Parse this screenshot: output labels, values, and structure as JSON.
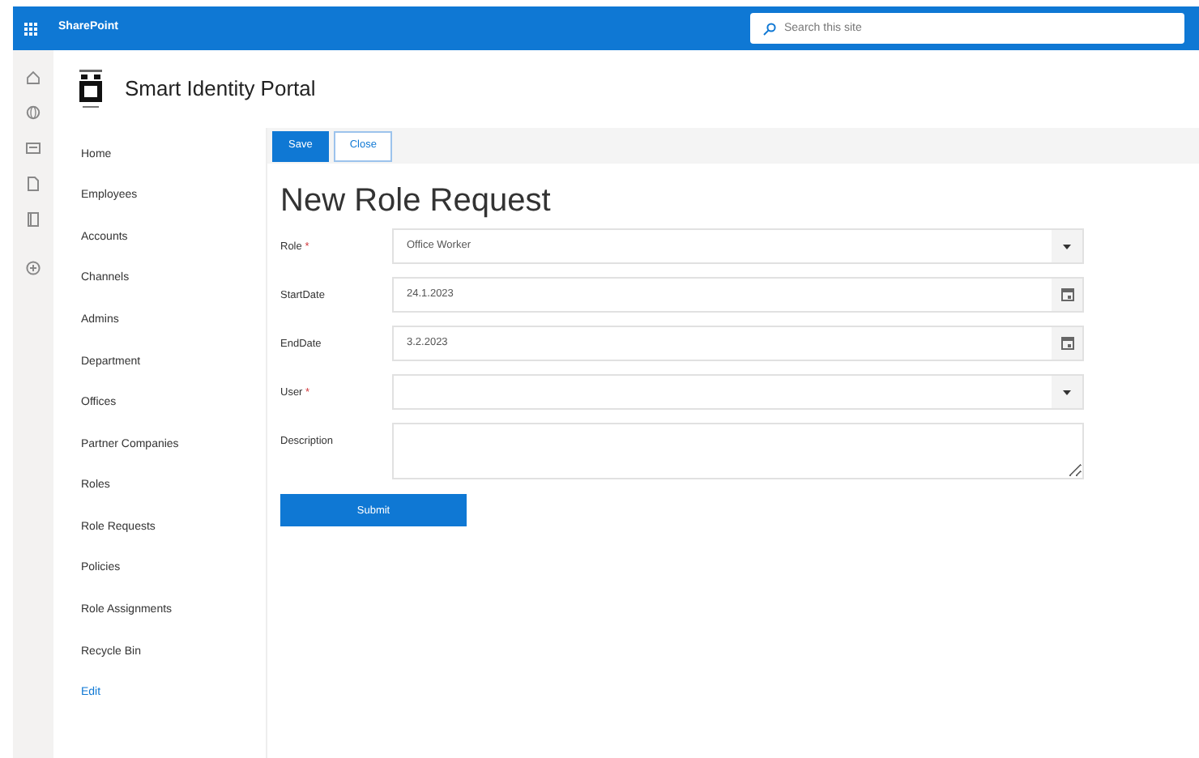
{
  "top_bar": {
    "app_name": "SharePoint",
    "search": {
      "placeholder": "Search this site"
    }
  },
  "site": {
    "title": "Smart Identity Portal"
  },
  "nav": {
    "items": [
      {
        "label": "Home",
        "kind": "link"
      },
      {
        "label": "Employees",
        "kind": "link"
      },
      {
        "label": "Accounts",
        "kind": "link"
      },
      {
        "label": "Channels",
        "kind": "link"
      },
      {
        "label": "Admins",
        "kind": "link"
      },
      {
        "label": "Department",
        "kind": "link"
      },
      {
        "label": "Offices",
        "kind": "link"
      },
      {
        "label": "Partner Companies",
        "kind": "link"
      },
      {
        "label": "Roles",
        "kind": "link"
      },
      {
        "label": "Role Requests",
        "kind": "link"
      },
      {
        "label": "Policies",
        "kind": "link"
      },
      {
        "label": "Role Assignments",
        "kind": "link"
      },
      {
        "label": "Recycle Bin",
        "kind": "link"
      },
      {
        "label": "Edit",
        "kind": "action"
      }
    ]
  },
  "toolbar": {
    "buttons": [
      {
        "label": "Save",
        "kind": "primary"
      },
      {
        "label": "Close",
        "kind": "secondary"
      }
    ]
  },
  "form": {
    "title": "New Role Request",
    "fields": [
      {
        "label": "Role",
        "required_mark": "*",
        "kind": "dropdown",
        "value": "Office Worker"
      },
      {
        "label": "StartDate",
        "kind": "date",
        "value": "24.1.2023"
      },
      {
        "label": "EndDate",
        "kind": "date",
        "value": "3.2.2023"
      },
      {
        "label": "User",
        "required_mark": "*",
        "kind": "dropdown"
      },
      {
        "label": "Description",
        "kind": "textarea"
      }
    ],
    "submit": "Submit"
  }
}
